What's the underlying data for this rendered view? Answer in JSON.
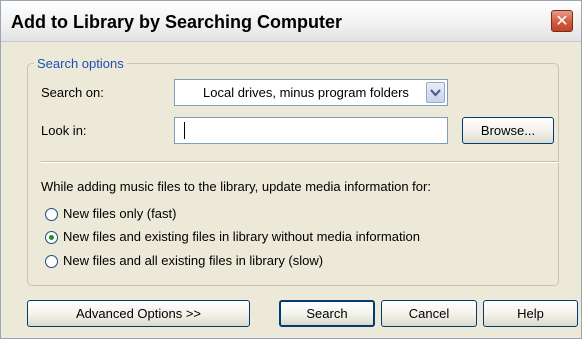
{
  "window": {
    "title": "Add to Library by Searching Computer",
    "close_glyph": "✕"
  },
  "search_options": {
    "legend": "Search options",
    "search_on_label": "Search on:",
    "search_on_value": "Local drives, minus program folders",
    "look_in_label": "Look in:",
    "look_in_value": "",
    "browse_label": "Browse...",
    "update_prompt": "While adding music files to the library, update media information for:",
    "options": [
      {
        "label": "New files only (fast)",
        "selected": false
      },
      {
        "label": "New files and existing files in library without media information",
        "selected": true
      },
      {
        "label": "New files and all existing files in library (slow)",
        "selected": false
      }
    ]
  },
  "footer": {
    "advanced_label": "Advanced Options >>",
    "search_label": "Search",
    "cancel_label": "Cancel",
    "help_label": "Help"
  },
  "icons": {
    "close": "close-icon",
    "dropdown": "chevron-down-icon"
  },
  "colors": {
    "dialog_bg": "#ece9d8",
    "legend_text": "#1e4fb5",
    "close_button": "#d25b3e"
  }
}
